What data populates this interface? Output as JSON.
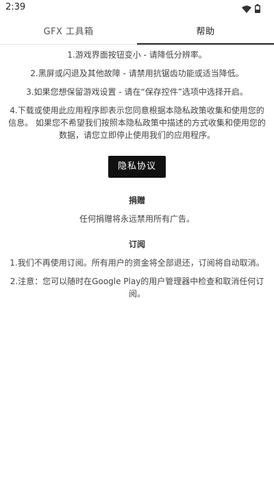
{
  "status_bar": {
    "time": "2:39"
  },
  "tabs": [
    {
      "label": "GFX 工具箱"
    },
    {
      "label": "帮助"
    }
  ],
  "help": {
    "items": [
      "1.游戏界面按钮变小 - 请降低分辨率。",
      "2.黑屏或闪退及其他故障 - 请禁用抗锯齿功能或适当降低。",
      "3.如果您想保留游戏设置 - 请在“保存控件”选项中选择开启。",
      "4.下载或使用此应用程序即表示您同意根据本隐私政策收集和使用您的信息。 如果您不希望我们按照本隐私政策中描述的方式收集和使用您的数据，请您立即停止使用我们的应用程序。"
    ],
    "privacy_button": "隐私协议"
  },
  "donation": {
    "title": "捐赠",
    "text": "任何捐赠将永远禁用所有广告。"
  },
  "subscription": {
    "title": "订阅",
    "items": [
      "1.我们不再使用订阅。所有用户的资金将全部退还，订阅将自动取消。",
      "2.注意：您可以随时在Google Play的用户管理器中检查和取消任何订阅。"
    ]
  }
}
